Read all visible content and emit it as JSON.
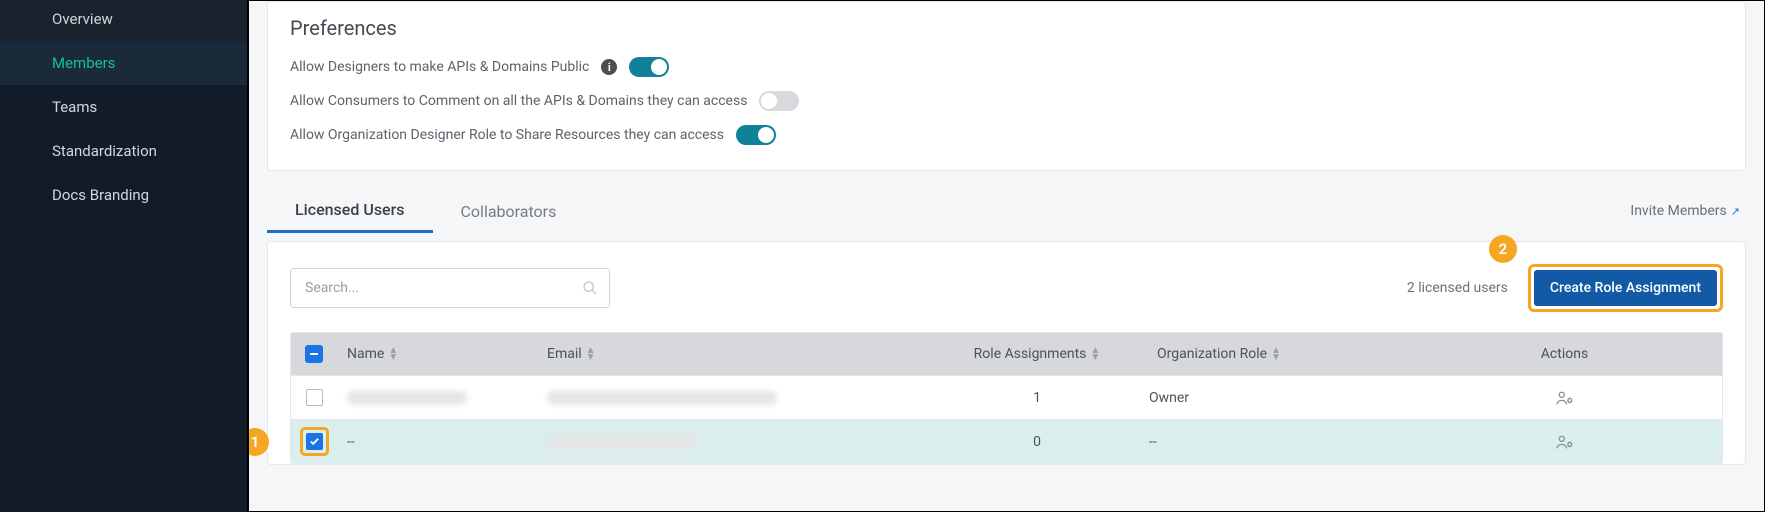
{
  "sidebar": {
    "items": [
      {
        "label": "Overview"
      },
      {
        "label": "Members"
      },
      {
        "label": "Teams"
      },
      {
        "label": "Standardization"
      },
      {
        "label": "Docs Branding"
      }
    ]
  },
  "preferences": {
    "title": "Preferences",
    "rows": [
      {
        "label": "Allow Designers to make APIs & Domains Public",
        "info": true,
        "on": true
      },
      {
        "label": "Allow Consumers to Comment on all the APIs & Domains they can access",
        "info": false,
        "on": false
      },
      {
        "label": "Allow Organization Designer Role to Share Resources they can access",
        "info": false,
        "on": true
      }
    ]
  },
  "tabs": {
    "licensed": "Licensed Users",
    "collaborators": "Collaborators",
    "invite": "Invite Members"
  },
  "users": {
    "search_placeholder": "Search...",
    "count_text": "2 licensed users",
    "create_label": "Create Role Assignment",
    "headers": {
      "name": "Name",
      "email": "Email",
      "role_assignments": "Role Assignments",
      "org_role": "Organization Role",
      "actions": "Actions"
    },
    "rows": [
      {
        "checked": false,
        "name": "",
        "email": "",
        "role_assignments": "1",
        "org_role": "Owner"
      },
      {
        "checked": true,
        "name": "--",
        "email": "",
        "role_assignments": "0",
        "org_role": "--"
      }
    ]
  },
  "callouts": {
    "one": "1",
    "two": "2"
  }
}
